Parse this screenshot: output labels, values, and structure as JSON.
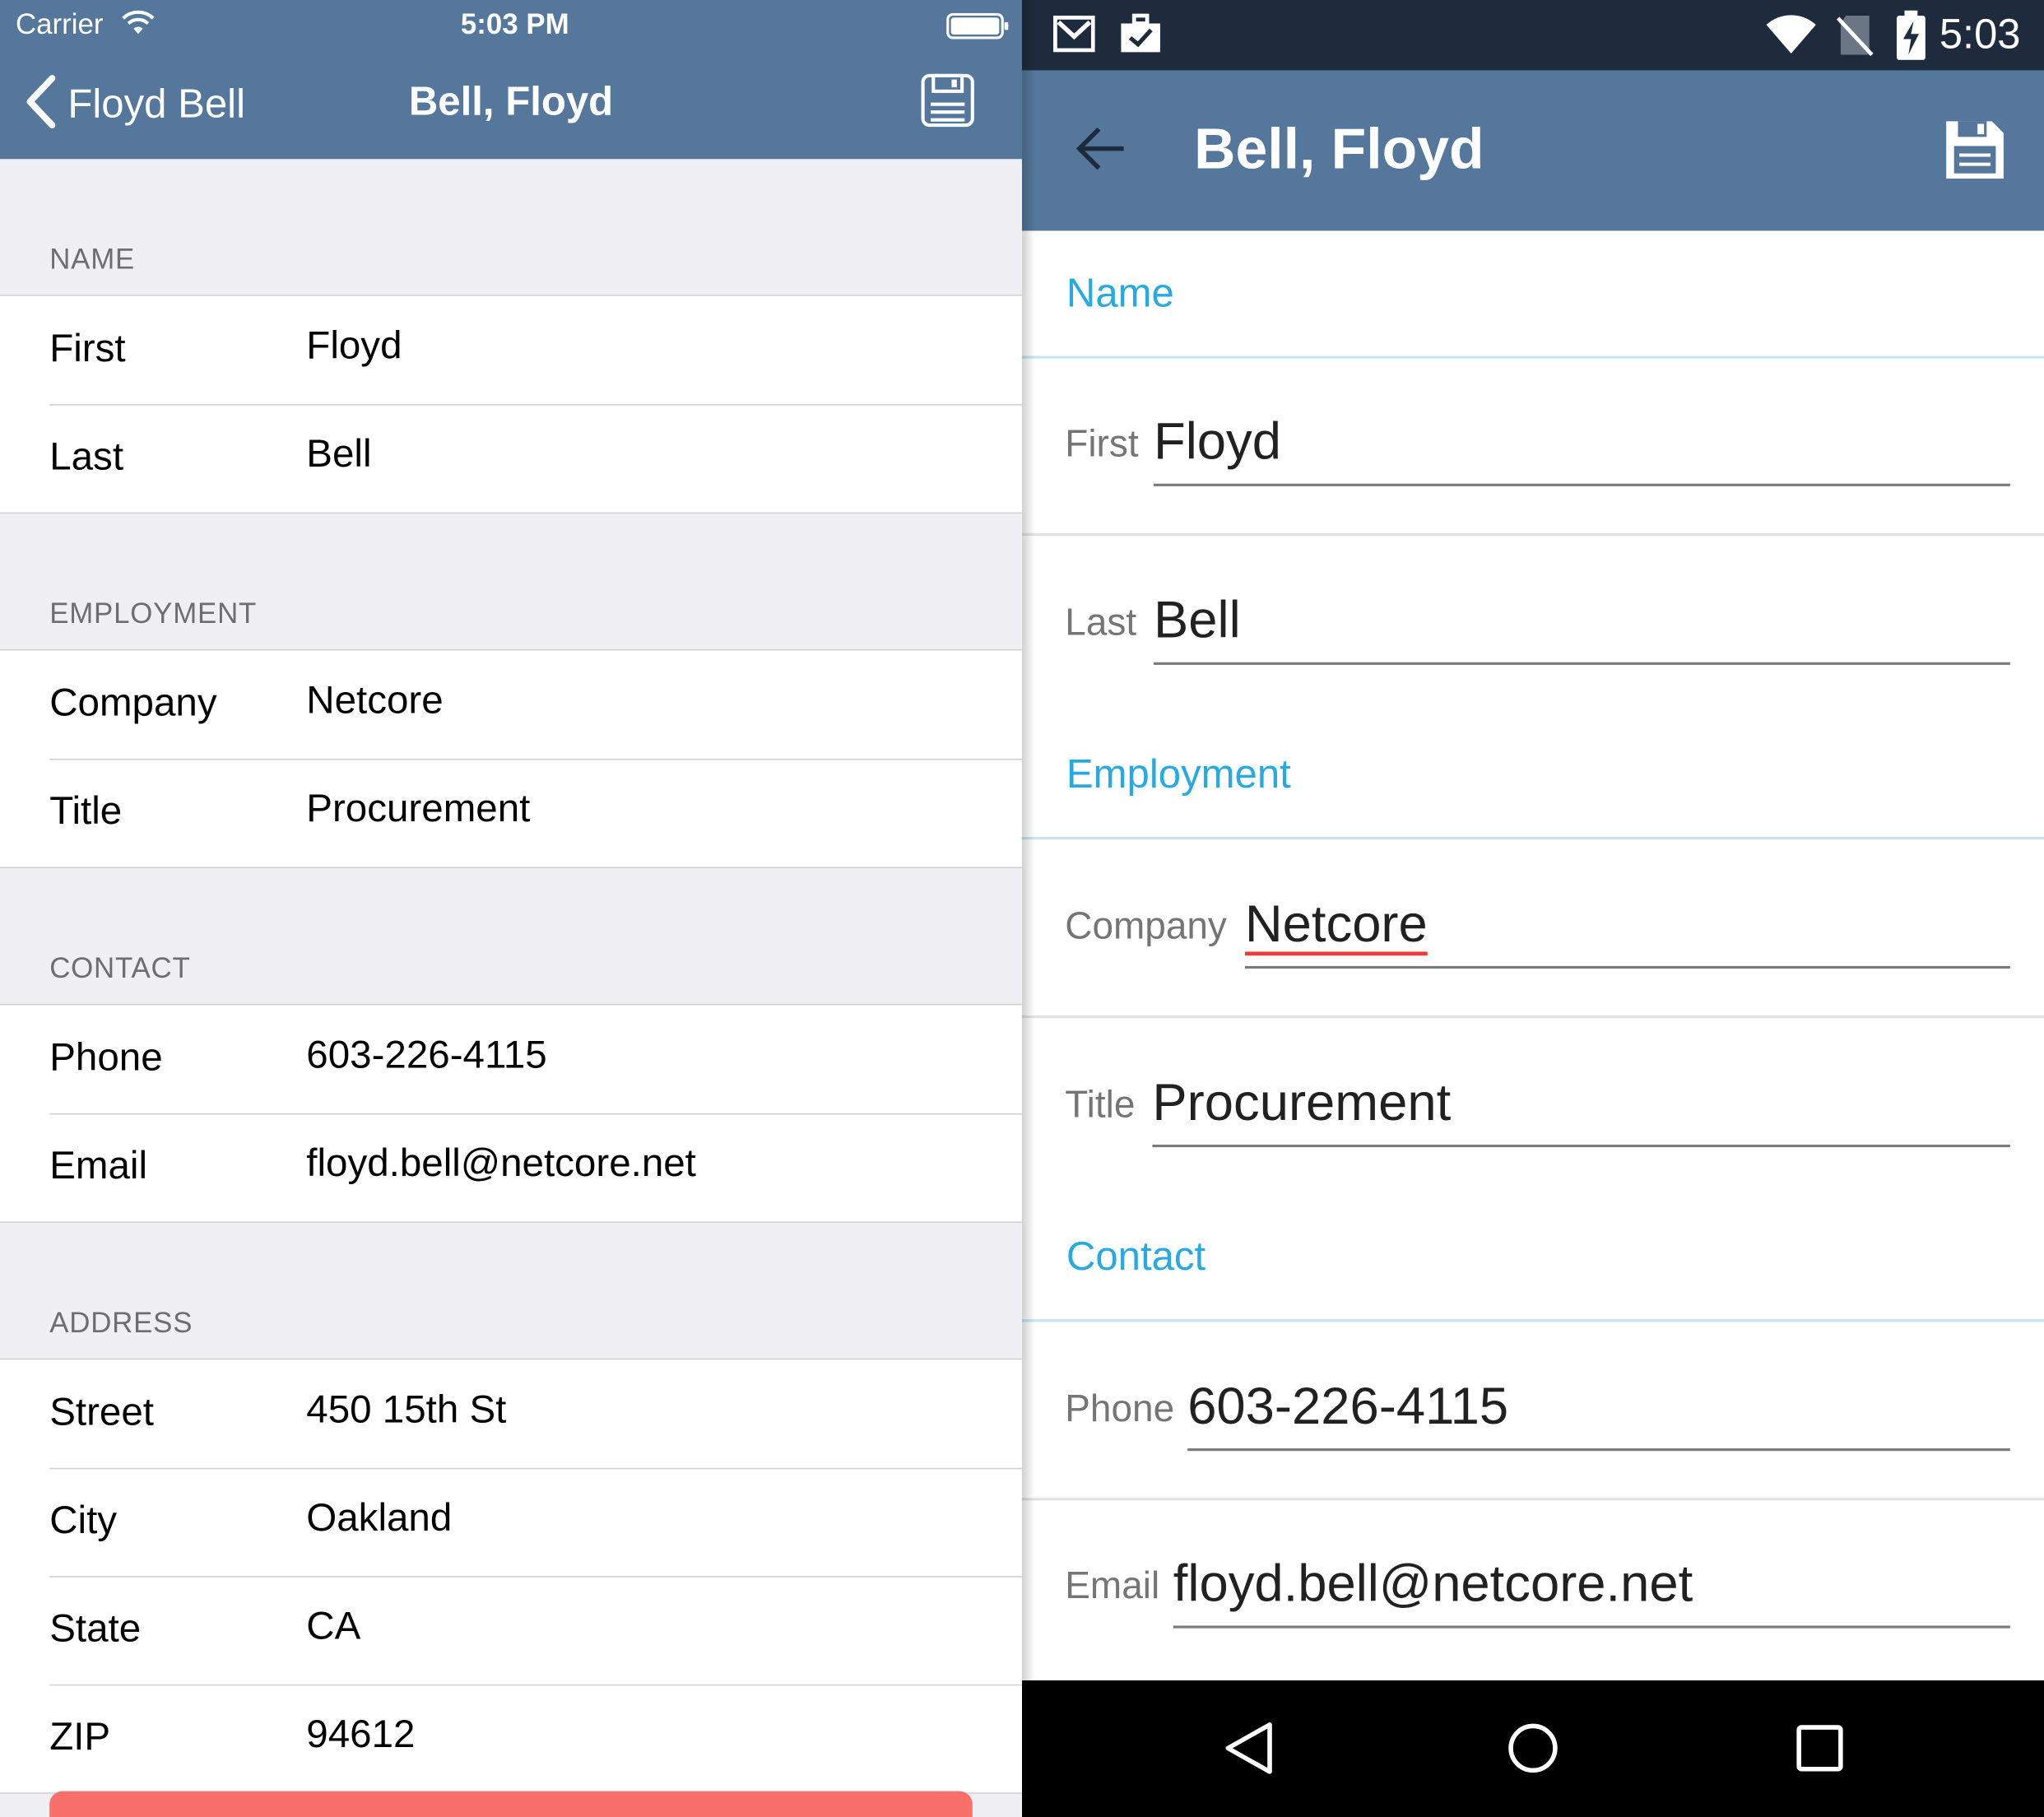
{
  "ios": {
    "status": {
      "carrier": "Carrier",
      "time": "5:03 PM"
    },
    "nav": {
      "back_label": "Floyd Bell",
      "title": "Bell, Floyd"
    },
    "sections": [
      {
        "header": "NAME",
        "rows": [
          {
            "label": "First",
            "value": "Floyd"
          },
          {
            "label": "Last",
            "value": "Bell"
          }
        ]
      },
      {
        "header": "EMPLOYMENT",
        "rows": [
          {
            "label": "Company",
            "value": "Netcore"
          },
          {
            "label": "Title",
            "value": "Procurement"
          }
        ]
      },
      {
        "header": "CONTACT",
        "rows": [
          {
            "label": "Phone",
            "value": "603-226-4115"
          },
          {
            "label": "Email",
            "value": "floyd.bell@netcore.net"
          }
        ]
      },
      {
        "header": "ADDRESS",
        "rows": [
          {
            "label": "Street",
            "value": "450 15th St"
          },
          {
            "label": "City",
            "value": "Oakland"
          },
          {
            "label": "State",
            "value": "CA"
          },
          {
            "label": "ZIP",
            "value": "94612"
          }
        ]
      }
    ],
    "colors": {
      "nav_bar": "#54779b",
      "delete_button": "#f9706b"
    }
  },
  "android": {
    "status": {
      "time": "5:03"
    },
    "toolbar": {
      "title": "Bell, Floyd"
    },
    "sections": [
      {
        "header": "Name",
        "rows": [
          {
            "label": "First",
            "value": "Floyd"
          },
          {
            "label": "Last",
            "value": "Bell"
          }
        ]
      },
      {
        "header": "Employment",
        "rows": [
          {
            "label": "Company",
            "value": "Netcore"
          },
          {
            "label": "Title",
            "value": "Procurement"
          }
        ]
      },
      {
        "header": "Contact",
        "rows": [
          {
            "label": "Phone",
            "value": "603-226-4115"
          },
          {
            "label": "Email",
            "value": "floyd.bell@netcore.net"
          }
        ]
      }
    ],
    "icons": [
      "gmail-icon",
      "briefcase-notification-icon",
      "wifi-icon",
      "no-sim-icon",
      "battery-charging-icon",
      "back-arrow-icon",
      "save-icon",
      "nav-back-icon",
      "nav-home-icon",
      "nav-recents-icon"
    ],
    "colors": {
      "toolbar": "#54779b",
      "status_bar": "#1d2b3c",
      "section_header": "#27a9e1"
    }
  }
}
